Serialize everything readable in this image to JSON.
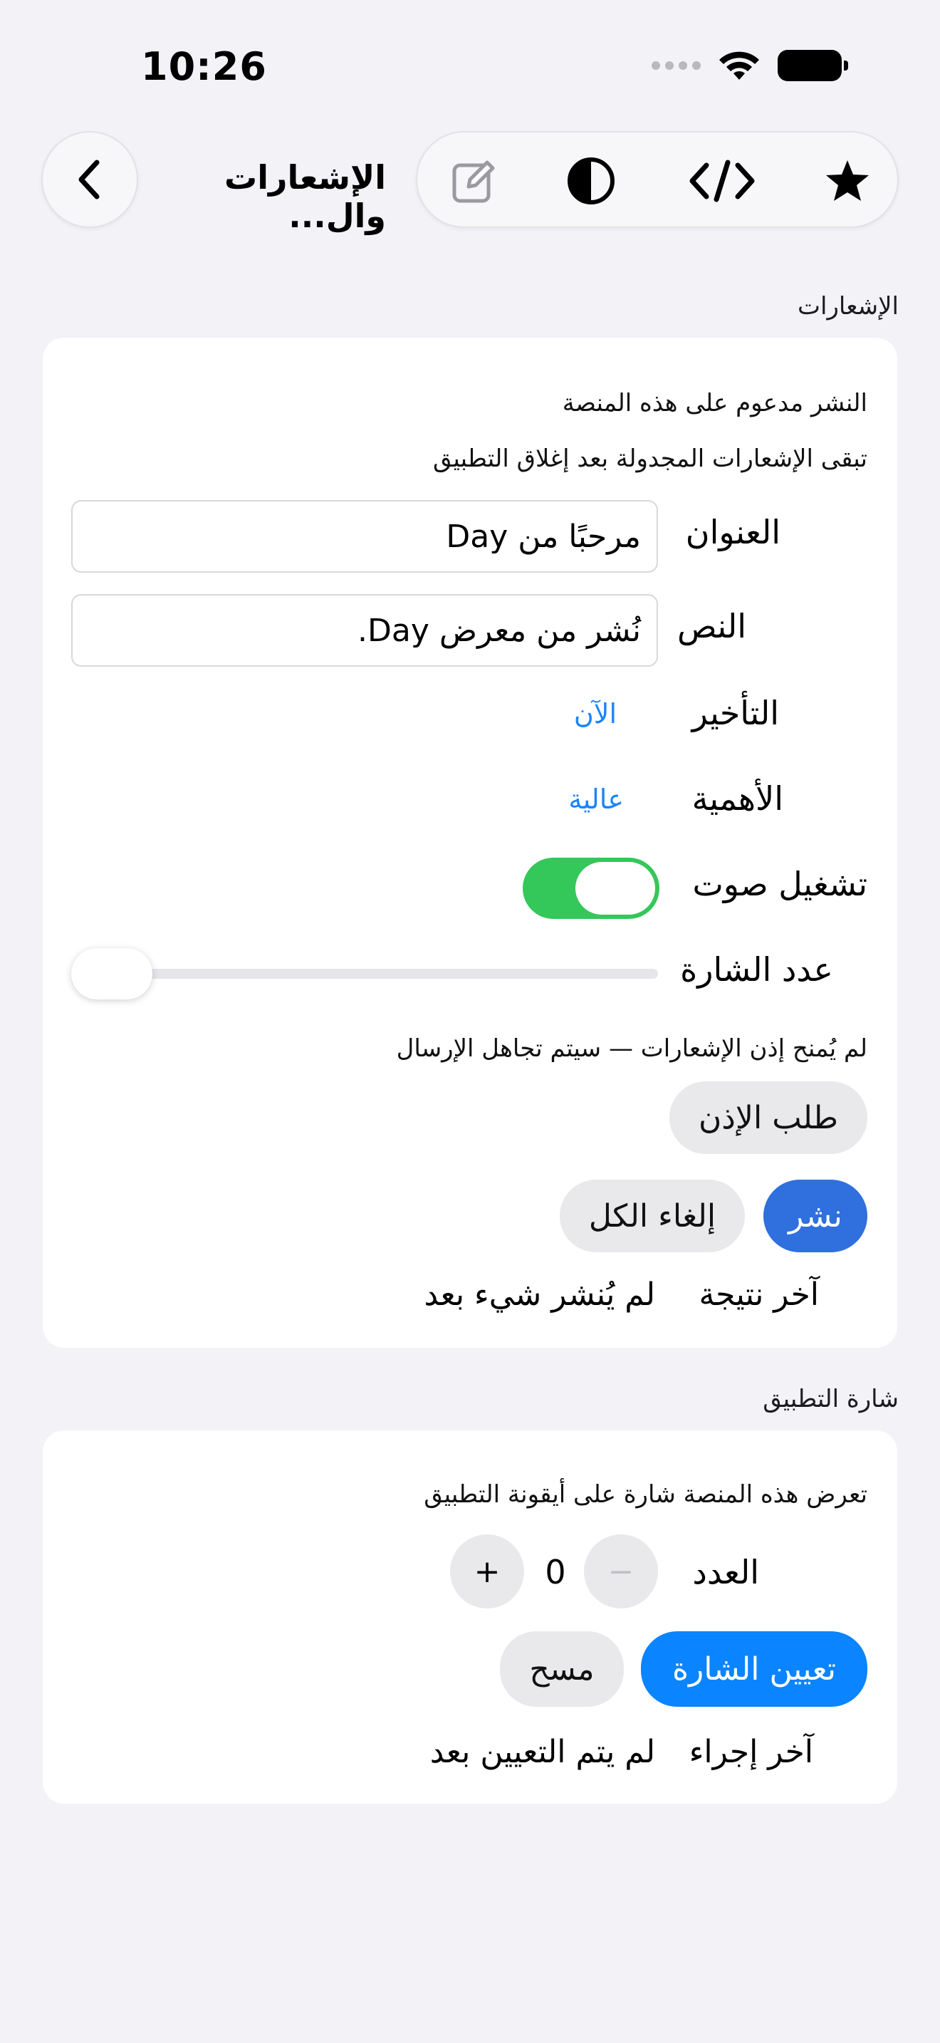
{
  "status": {
    "time": "10:26"
  },
  "nav": {
    "title": "الإشعارات وال..."
  },
  "toolbar": {
    "icons": [
      "star-icon",
      "code-icon",
      "contrast-icon",
      "edit-icon"
    ]
  },
  "notifications": {
    "header": "الإشعارات",
    "supported_text": "النشر مدعوم على هذه المنصة",
    "persist_text": "تبقى الإشعارات المجدولة بعد إغلاق التطبيق",
    "title_label": "العنوان",
    "title_value": "مرحبًا من Day",
    "body_label": "النص",
    "body_value": "نُشر من معرض Day.",
    "delay_label": "التأخير",
    "delay_value": "الآن",
    "importance_label": "الأهمية",
    "importance_value": "عالية",
    "sound_label": "تشغيل صوت",
    "sound_on": true,
    "badge_label": "عدد الشارة",
    "badge_slider_value": 0,
    "permission_text": "لم يُمنح إذن الإشعارات — سيتم تجاهل الإرسال",
    "request_permission": "طلب الإذن",
    "post_button": "نشر",
    "cancel_all_button": "إلغاء الكل",
    "last_result_label": "آخر نتيجة",
    "last_result_value": "لم يُنشر شيء بعد"
  },
  "badge": {
    "header": "شارة التطبيق",
    "info_text": "تعرض هذه المنصة شارة على أيقونة التطبيق",
    "count_label": "العدد",
    "count_value": "0",
    "minus": "−",
    "plus": "+",
    "set_button": "تعيين الشارة",
    "clear_button": "مسح",
    "last_action_label": "آخر إجراء",
    "last_action_value": "لم يتم التعيين بعد"
  },
  "colors": {
    "accent": "#0a84ff",
    "toggle_on": "#34c759",
    "post_button": "#2f6fde",
    "background": "#f2f2f7"
  }
}
